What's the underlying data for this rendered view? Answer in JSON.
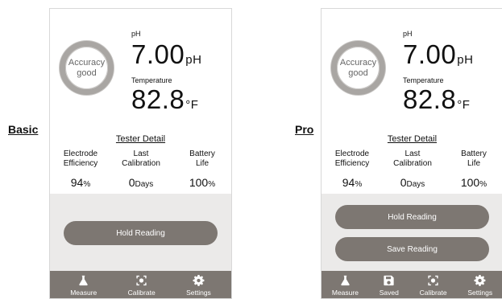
{
  "labels": {
    "basic": "Basic",
    "pro": "Pro"
  },
  "gauge": {
    "line1": "Accuracy",
    "line2": "good"
  },
  "ph": {
    "label": "pH",
    "value": "7.00",
    "unit": "pH"
  },
  "temperature": {
    "label": "Temperature",
    "value": "82.8",
    "unit": "°F"
  },
  "tester_detail": {
    "title": "Tester Detail"
  },
  "stats": {
    "electrode": {
      "line1": "Electrode",
      "line2": "Efficiency",
      "value": "94",
      "unit": "%"
    },
    "calibration": {
      "line1": "Last",
      "line2": "Calibration",
      "value": "0",
      "unit": "Days"
    },
    "battery": {
      "line1": "Battery",
      "line2": "Life",
      "value": "100",
      "unit": "%"
    }
  },
  "buttons": {
    "hold": "Hold Reading",
    "save": "Save Reading"
  },
  "tabs": {
    "measure": "Measure",
    "saved": "Saved",
    "calibrate": "Calibrate",
    "settings": "Settings"
  },
  "colors": {
    "accent": "#7d7772",
    "panel": "#ebeae9",
    "gauge_ring": "#a9a6a3"
  },
  "icons": {
    "measure": "flask-icon",
    "saved": "save-icon",
    "calibrate": "calibrate-target-icon",
    "settings": "gear-icon"
  }
}
